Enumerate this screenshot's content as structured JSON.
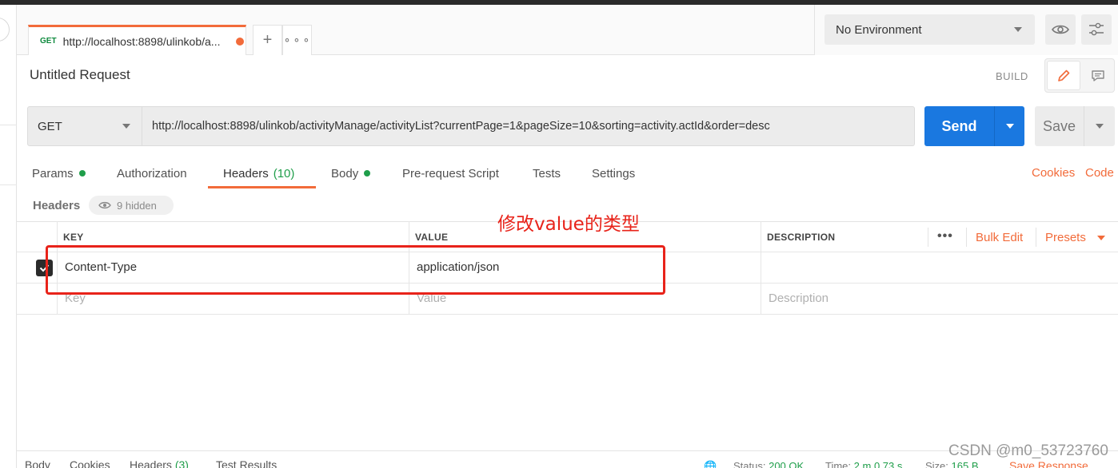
{
  "tab": {
    "method": "GET",
    "title": "http://localhost:8898/ulinkob/a..."
  },
  "environment": {
    "selected": "No Environment"
  },
  "request": {
    "title": "Untitled Request",
    "mode_label": "BUILD",
    "method": "GET",
    "url": "http://localhost:8898/ulinkob/activityManage/activityList?currentPage=1&pageSize=10&sorting=activity.actId&order=desc",
    "send_label": "Send",
    "save_label": "Save"
  },
  "subtabs": {
    "params": "Params",
    "authorization": "Authorization",
    "headers": "Headers",
    "headers_count": "(10)",
    "body": "Body",
    "prerequest": "Pre-request Script",
    "tests": "Tests",
    "settings": "Settings",
    "cookies": "Cookies",
    "code": "Code"
  },
  "headers_section": {
    "label": "Headers",
    "hidden": "9 hidden"
  },
  "table": {
    "columns": {
      "key": "KEY",
      "value": "VALUE",
      "description": "DESCRIPTION"
    },
    "more": "•••",
    "bulk_edit": "Bulk Edit",
    "presets": "Presets",
    "rows": [
      {
        "key": "Content-Type",
        "value": "application/json",
        "description": ""
      }
    ],
    "placeholders": {
      "key": "Key",
      "value": "Value",
      "description": "Description"
    }
  },
  "annotation": {
    "text": "修改value的类型",
    "color": "#e8231a"
  },
  "response_bar": {
    "tabs": {
      "body": "Body",
      "cookies": "Cookies",
      "headers": "Headers",
      "headers_count": "(3)",
      "test_results": "Test Results"
    },
    "status_label": "Status:",
    "status_value": "200 OK",
    "time_label": "Time:",
    "time_value": "2 m 0.73 s",
    "size_label": "Size:",
    "size_value": "165 B",
    "save_response": "Save Response"
  },
  "watermark": "CSDN @m0_53723760",
  "colors": {
    "accent": "#f26b3a",
    "send": "#1a78e0",
    "success": "#1f9e4a"
  }
}
